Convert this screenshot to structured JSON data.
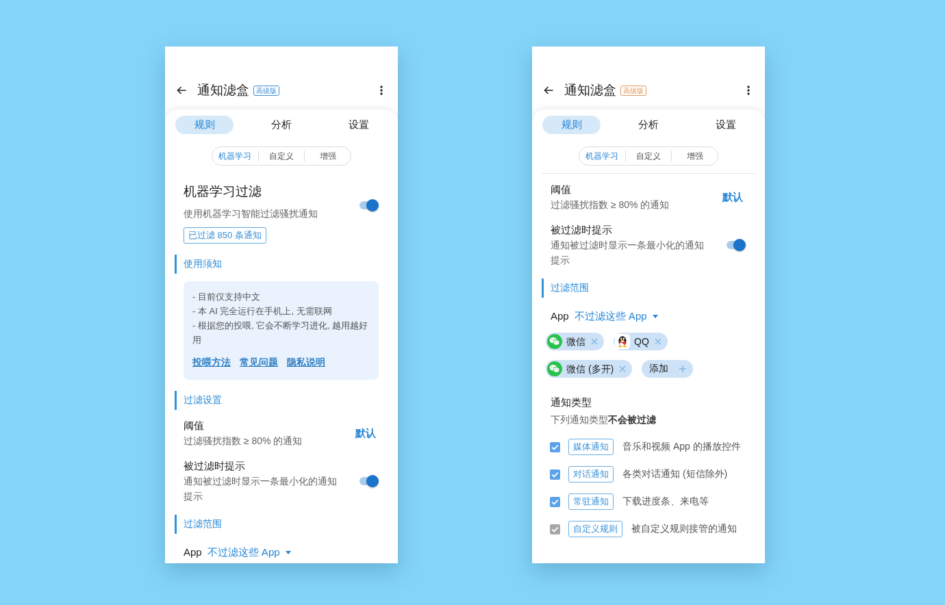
{
  "screens": [
    {
      "app_bar": {
        "title": "通知滤盒",
        "badge": {
          "label": "高级版",
          "color": "#3d8fd6"
        }
      },
      "tabs": [
        {
          "label": "规则",
          "selected": true
        },
        {
          "label": "分析",
          "selected": false
        },
        {
          "label": "设置",
          "selected": false
        }
      ],
      "segments": [
        {
          "label": "机器学习",
          "selected": true
        },
        {
          "label": "自定义",
          "selected": false
        },
        {
          "label": "增强",
          "selected": false
        }
      ],
      "content": [
        {
          "kind": "feature",
          "title": "机器学习过滤",
          "description": "使用机器学习智能过滤骚扰通知",
          "on": true,
          "counter": "已过滤 850 条通知"
        },
        {
          "kind": "header",
          "label": "使用须知"
        },
        {
          "kind": "notice",
          "lines": [
            "- 目前仅支持中文",
            "- 本 AI 完全运行在手机上, 无需联网",
            "- 根据您的投喂, 它会不断学习进化, 越用越好用"
          ],
          "links": [
            "投喂方法",
            "常见问题",
            "隐私说明"
          ]
        },
        {
          "kind": "header",
          "label": "过滤设置"
        },
        {
          "kind": "action",
          "title": "阈值",
          "description": "过滤骚扰指数 ≥ 80% 的通知",
          "action": "默认"
        },
        {
          "kind": "toggle",
          "title": "被过滤时提示",
          "description": "通知被过滤时显示一条最小化的通知提示",
          "on": true
        },
        {
          "kind": "header",
          "label": "过滤范围"
        },
        {
          "kind": "apps",
          "label": "App",
          "mode": "不过滤这些 App"
        }
      ]
    },
    {
      "app_bar": {
        "title": "通知滤盒",
        "badge": {
          "label": "高级版",
          "color": "#e0975a"
        }
      },
      "tabs": [
        {
          "label": "规则",
          "selected": true
        },
        {
          "label": "分析",
          "selected": false
        },
        {
          "label": "设置",
          "selected": false
        }
      ],
      "segments": [
        {
          "label": "机器学习",
          "selected": true
        },
        {
          "label": "自定义",
          "selected": false
        },
        {
          "label": "增强",
          "selected": false
        }
      ],
      "content": [
        {
          "kind": "divider"
        },
        {
          "kind": "action",
          "title": "阈值",
          "description": "过滤骚扰指数 ≥ 80% 的通知",
          "action": "默认"
        },
        {
          "kind": "toggle",
          "title": "被过滤时提示",
          "description": "通知被过滤时显示一条最小化的通知提示",
          "on": true
        },
        {
          "kind": "header",
          "label": "过滤范围"
        },
        {
          "kind": "apps",
          "label": "App",
          "mode": "不过滤这些 App",
          "chips": [
            {
              "label": "微信",
              "kind": "bubbles"
            },
            {
              "label": "QQ",
              "kind": "penguin"
            },
            {
              "label": "微信 (多开)",
              "kind": "bubbles"
            },
            {
              "label": "添加",
              "kind": "add"
            }
          ]
        },
        {
          "kind": "types",
          "title": "通知类型",
          "subtitle": "下列通知类型**不会被过滤**",
          "items": [
            {
              "tag": "媒体通知",
              "description": "音乐和视频 App 的播放控件",
              "checked": true,
              "disabled": false
            },
            {
              "tag": "对话通知",
              "description": "各类对话通知 (短信除外)",
              "checked": true,
              "disabled": false
            },
            {
              "tag": "常驻通知",
              "description": "下载进度条、来电等",
              "checked": true,
              "disabled": false
            },
            {
              "tag": "自定义规则",
              "description": "被自定义规则接管的通知",
              "checked": true,
              "disabled": true
            }
          ]
        }
      ]
    }
  ]
}
